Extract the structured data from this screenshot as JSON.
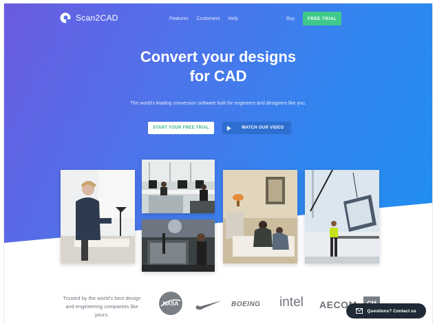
{
  "brand": {
    "name": "Scan2CAD"
  },
  "nav": {
    "links": [
      "Features",
      "Customers",
      "Help"
    ],
    "buy": "Buy",
    "trial_button": "FREE TRIAL"
  },
  "hero": {
    "headline_line1": "Convert your designs",
    "headline_line2": "for CAD",
    "subtitle": "The world's leading conversion software built for engineers and designers like you.",
    "cta_primary": "START YOUR FREE TRIAL",
    "cta_video": "WATCH OUR VIDEO"
  },
  "trusted": {
    "text": "Trusted by the world's best design and engineering companies like yours."
  },
  "logos": {
    "nasa": "NASA",
    "boeing": "BOEING",
    "intel": "intel",
    "aecom": "AECOM",
    "partial": "CM"
  },
  "chat": {
    "label": "Questions? Contact us"
  },
  "colors": {
    "accent_green": "#3ec98a",
    "hero_start": "#6a5be0",
    "hero_end": "#1f8ff0",
    "chat_bg": "#1f2a36"
  }
}
